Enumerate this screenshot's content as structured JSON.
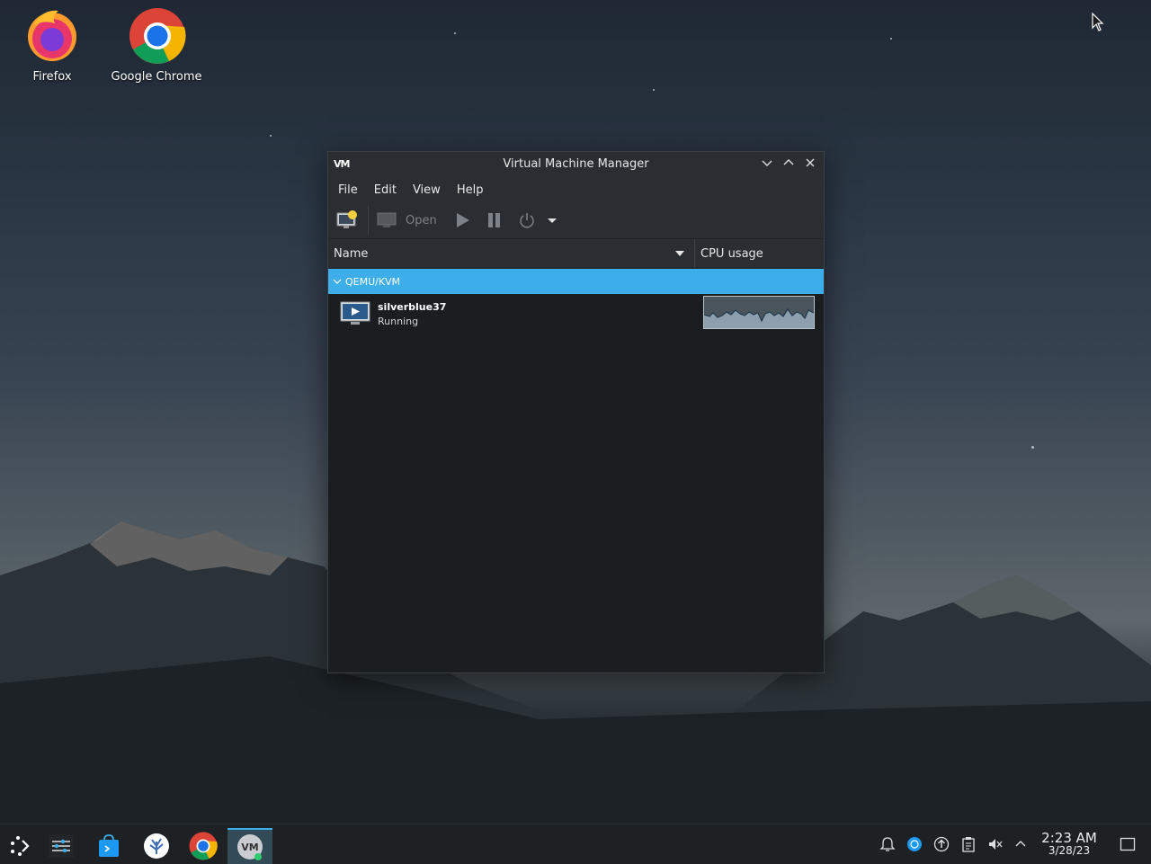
{
  "desktop": {
    "icons": [
      {
        "label": "Firefox",
        "icon": "firefox-icon"
      },
      {
        "label": "Google Chrome",
        "icon": "chrome-icon"
      }
    ]
  },
  "window": {
    "title": "Virtual Machine Manager",
    "app_logo": "VM",
    "menu": [
      "File",
      "Edit",
      "View",
      "Help"
    ],
    "toolbar": {
      "open_label": "Open"
    },
    "columns": {
      "name": "Name",
      "cpu": "CPU usage"
    },
    "group": {
      "label": "QEMU/KVM"
    },
    "vm": {
      "name": "silverblue37",
      "status": "Running"
    }
  },
  "taskbar": {
    "clock": {
      "time": "2:23 AM",
      "date": "3/28/23"
    }
  },
  "colors": {
    "accent": "#3daee9",
    "window_bg": "#1b1e20",
    "titlebar_bg": "#2a2e32"
  }
}
